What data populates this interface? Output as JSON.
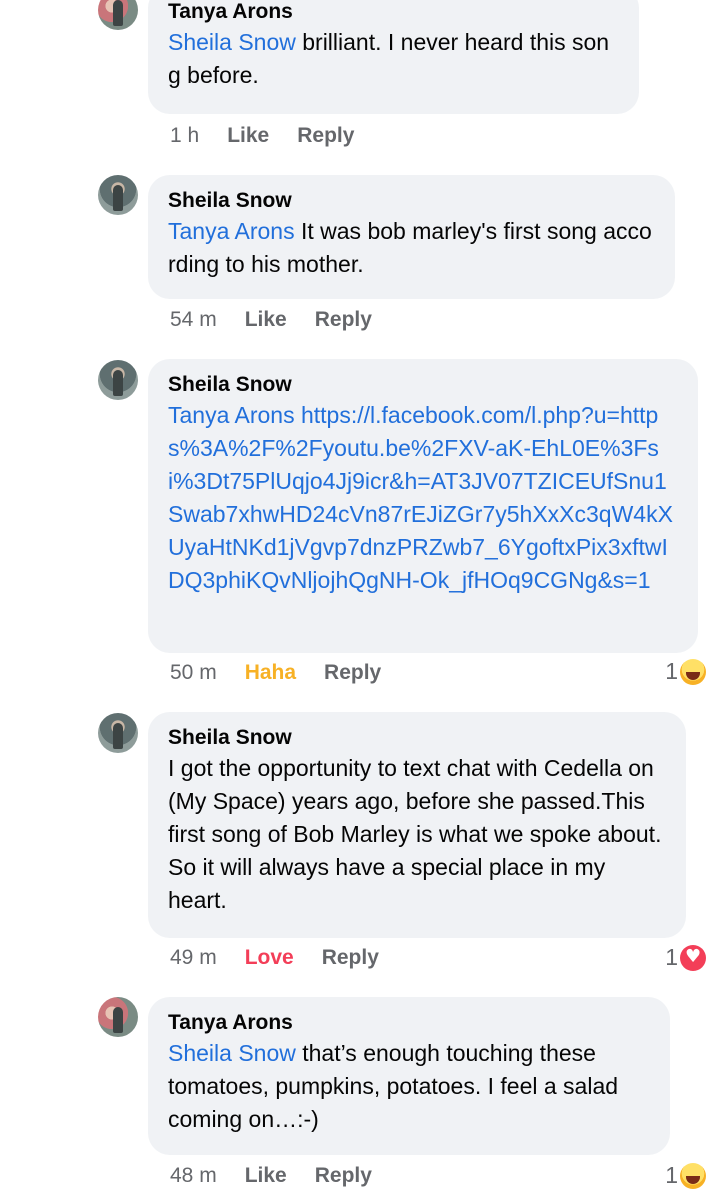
{
  "comments": [
    {
      "author": "Tanya Arons",
      "mention": "Sheila Snow",
      "text": " brilliant.  I never heard this song before.",
      "time": "1 h",
      "reaction_action": "Like",
      "reply": "Reply"
    },
    {
      "author": "Sheila Snow",
      "mention": "Tanya Arons",
      "text": " It was bob marley's first song according to his mother.",
      "time": "54 m",
      "reaction_action": "Like",
      "reply": "Reply"
    },
    {
      "author": "Sheila Snow",
      "mention": "Tanya Arons",
      "link": "https://l.facebook.com/l.php?u=https%3A%2F%2Fyoutu.be%2FXV-aK-EhL0E%3Fsi%3Dt75PlUqjo4Jj9icr&h=AT3JV07TZICEUfSnu1Swab7xhwHD24cVn87rEJiZGr7y5hXxXc3qW4kXUyaHtNKd1jVgvp7dnzPRZwb7_6YgoftxPix3xftwIDQ3phiKQvNljojhQgNH-Ok_jfHOq9CGNg&s=1",
      "time": "50 m",
      "reaction_action": "Haha",
      "reply": "Reply",
      "reaction_count": "1",
      "reaction_icon": "haha-emoji-icon"
    },
    {
      "author": "Sheila Snow",
      "text": "I got the opportunity to text chat with Cedella on (My Space) years ago, before she passed.This first song of Bob Marley is what we spoke about. So it will always have a special place in my heart.",
      "time": "49 m",
      "reaction_action": "Love",
      "reply": "Reply",
      "reaction_count": "1",
      "reaction_icon": "love-heart-icon"
    },
    {
      "author": "Tanya Arons",
      "mention": "Sheila Snow",
      "text": " that’s enough touching these tomatoes, pumpkins, potatoes.  I feel a salad coming on…:-)",
      "time": "48 m",
      "reaction_action": "Like",
      "reply": "Reply",
      "reaction_count": "1",
      "reaction_icon": "haha-emoji-icon"
    }
  ]
}
